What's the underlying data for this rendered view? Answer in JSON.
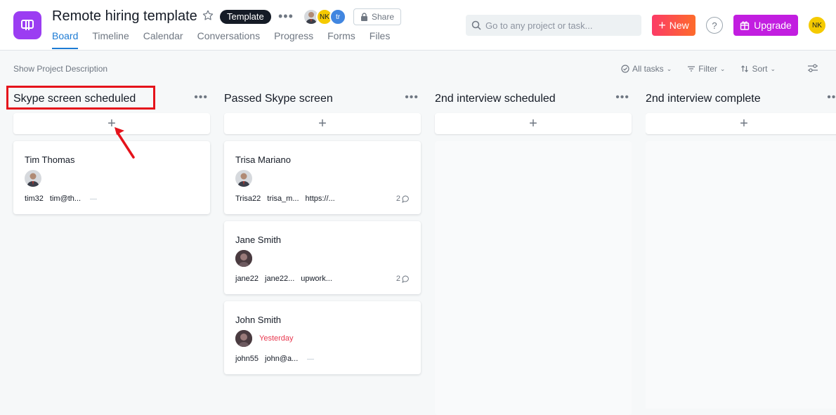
{
  "header": {
    "title": "Remote hiring template",
    "template_badge": "Template",
    "share_label": "Share",
    "members": [
      {
        "initials": "",
        "color": "#8a8f98"
      },
      {
        "initials": "NK",
        "color": "#f5ca00"
      },
      {
        "initials": "tr",
        "color": "#4186e0"
      }
    ]
  },
  "tabs": [
    {
      "label": "Board",
      "active": true
    },
    {
      "label": "Timeline"
    },
    {
      "label": "Calendar"
    },
    {
      "label": "Conversations"
    },
    {
      "label": "Progress"
    },
    {
      "label": "Forms"
    },
    {
      "label": "Files"
    }
  ],
  "search": {
    "placeholder": "Go to any project or task..."
  },
  "new_label": "New",
  "help_label": "?",
  "upgrade_label": "Upgrade",
  "user_initials": "NK",
  "toolbar": {
    "description_label": "Show Project Description",
    "all_tasks_label": "All tasks",
    "filter_label": "Filter",
    "sort_label": "Sort"
  },
  "columns": [
    {
      "title": "Skype screen scheduled",
      "add_label": "+",
      "cards": [
        {
          "name": "Tim Thomas",
          "avatar": "photo-man",
          "fields": [
            "tim32",
            "tim@th..."
          ],
          "dash": true
        }
      ]
    },
    {
      "title": "Passed Skype screen",
      "add_label": "+",
      "cards": [
        {
          "name": "Trisa Mariano",
          "avatar": "photo-man",
          "fields": [
            "Trisa22",
            "trisa_m...",
            "https://..."
          ],
          "comments": "2"
        },
        {
          "name": "Jane Smith",
          "avatar": "photo-dark",
          "fields": [
            "jane22",
            "jane22...",
            "upwork..."
          ],
          "comments": "2"
        },
        {
          "name": "John Smith",
          "avatar": "photo-dark",
          "due": "Yesterday",
          "fields": [
            "john55",
            "john@a..."
          ],
          "dash": true
        }
      ]
    },
    {
      "title": "2nd interview scheduled",
      "add_label": "+",
      "cards": []
    },
    {
      "title": "2nd interview complete",
      "add_label": "+",
      "cards": []
    }
  ],
  "colors": {
    "accent": "#1d7bd4",
    "project_icon": "#9b3df2",
    "upgrade": "#c21ee0",
    "due_overdue": "#e8384f",
    "annotation": "#e5131b"
  }
}
